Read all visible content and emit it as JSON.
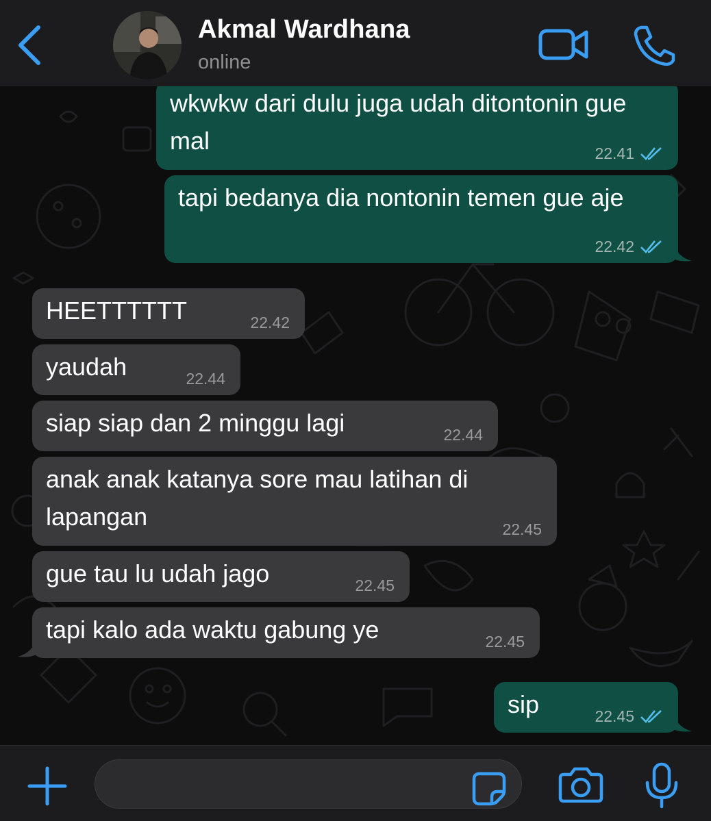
{
  "header": {
    "back_icon": "chevron-left-icon",
    "contact_name": "Akmal Wardhana",
    "contact_status": "online",
    "video_icon": "video-camera-icon",
    "call_icon": "phone-icon"
  },
  "colors": {
    "accent": "#3b9ef5",
    "outgoing_bubble": "#0f4f44",
    "incoming_bubble": "#3a3a3c",
    "read_ticks": "#53bdeb"
  },
  "messages": [
    {
      "direction": "outgoing",
      "text": "wkwkw dari dulu juga udah ditontonin gue mal",
      "time": "22.41",
      "status": "read"
    },
    {
      "direction": "outgoing",
      "text": "tapi bedanya dia nontonin temen gue aje",
      "time": "22.42",
      "status": "read"
    },
    {
      "direction": "incoming",
      "text": "HEETTTTTT",
      "time": "22.42"
    },
    {
      "direction": "incoming",
      "text": "yaudah",
      "time": "22.44"
    },
    {
      "direction": "incoming",
      "text": "siap siap dan 2 minggu lagi",
      "time": "22.44"
    },
    {
      "direction": "incoming",
      "text": "anak anak katanya sore mau latihan di lapangan",
      "time": "22.45"
    },
    {
      "direction": "incoming",
      "text": "gue tau lu udah jago",
      "time": "22.45"
    },
    {
      "direction": "incoming",
      "text": "tapi kalo ada waktu gabung ye",
      "time": "22.45"
    },
    {
      "direction": "outgoing",
      "text": "sip",
      "time": "22.45",
      "status": "read"
    }
  ],
  "input_bar": {
    "plus_icon": "plus-icon",
    "message_value": "",
    "sticker_icon": "sticker-icon",
    "camera_icon": "camera-icon",
    "mic_icon": "microphone-icon"
  }
}
